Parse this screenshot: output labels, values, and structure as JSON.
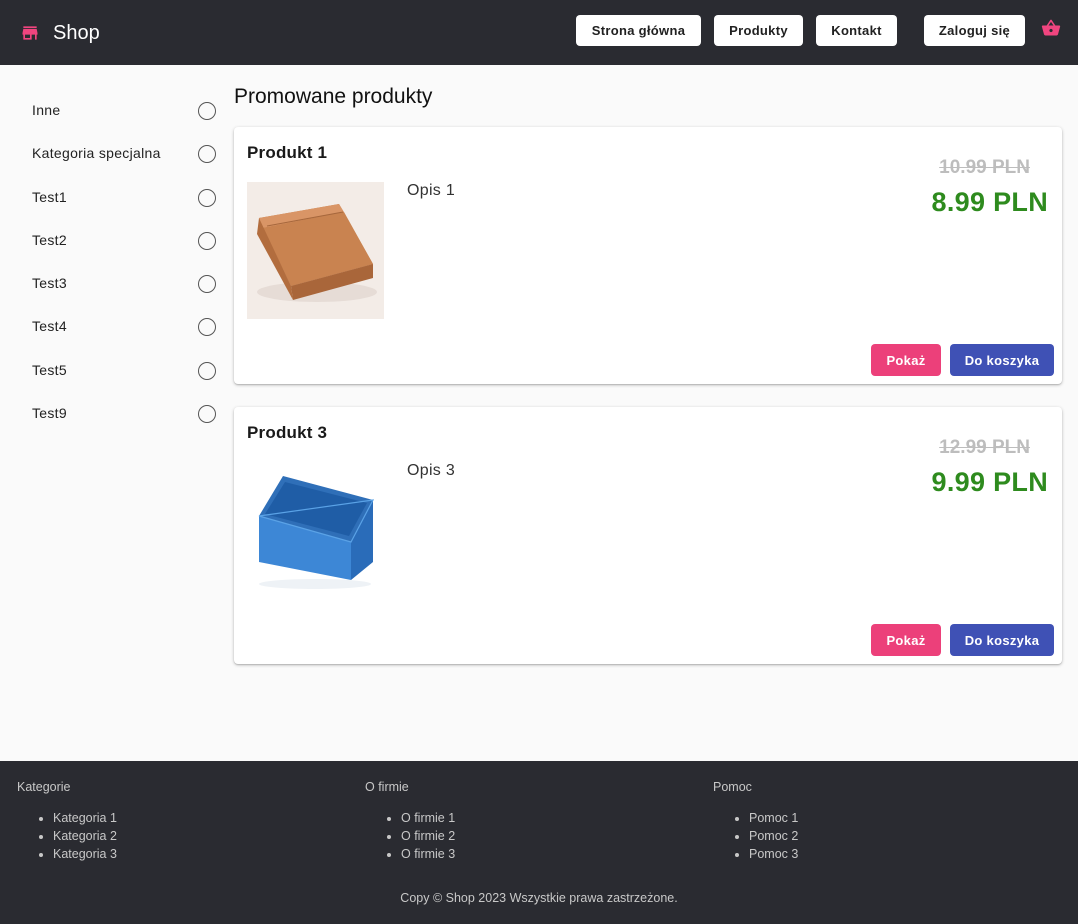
{
  "header": {
    "brand": "Shop",
    "nav": [
      "Strona główna",
      "Produkty",
      "Kontakt",
      "Zaloguj się"
    ],
    "brand_color": "#f0457f",
    "bg_color": "#2a2b31"
  },
  "sidebar": {
    "categories": [
      "Inne",
      "Kategoria specjalna",
      "Test1",
      "Test2",
      "Test3",
      "Test4",
      "Test5",
      "Test9"
    ]
  },
  "main": {
    "title": "Promowane produkty",
    "products": [
      {
        "name": "Produkt 1",
        "description": "Opis 1",
        "old_price": "10.99 PLN",
        "price": "8.99 PLN",
        "image": "cardboard-box",
        "show_label": "Pokaż",
        "cart_label": "Do koszyka"
      },
      {
        "name": "Produkt 3",
        "description": "Opis 3",
        "old_price": "12.99 PLN",
        "price": "9.99 PLN",
        "image": "blue-plastic-box",
        "show_label": "Pokaż",
        "cart_label": "Do koszyka"
      }
    ]
  },
  "footer": {
    "columns": [
      {
        "title": "Kategorie",
        "items": [
          "Kategoria 1",
          "Kategoria 2",
          "Kategoria 3"
        ]
      },
      {
        "title": "O firmie",
        "items": [
          "O firmie 1",
          "O firmie 2",
          "O firmie 3"
        ]
      },
      {
        "title": "Pomoc",
        "items": [
          "Pomoc 1",
          "Pomoc 2",
          "Pomoc 3"
        ]
      }
    ],
    "copyright": "Copy © Shop 2023 Wszystkie prawa zastrzeżone."
  }
}
